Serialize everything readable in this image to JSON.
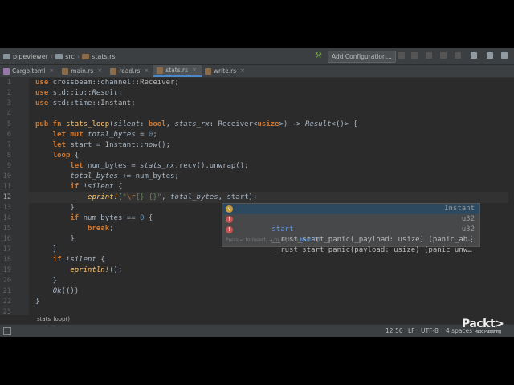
{
  "breadcrumbs": [
    "pipeviewer",
    "src",
    "stats.rs"
  ],
  "run_config": "Add Configuration...",
  "tabs": [
    {
      "label": "Cargo.toml",
      "color": "#9876aa",
      "active": false
    },
    {
      "label": "main.rs",
      "color": "#8a6b4a",
      "active": false
    },
    {
      "label": "read.rs",
      "color": "#8a6b4a",
      "active": false
    },
    {
      "label": "stats.rs",
      "color": "#8a6b4a",
      "active": true
    },
    {
      "label": "write.rs",
      "color": "#8a6b4a",
      "active": false
    }
  ],
  "line_numbers": [
    "1",
    "2",
    "3",
    "4",
    "5",
    "6",
    "7",
    "8",
    "9",
    "10",
    "11",
    "12",
    "13",
    "14",
    "15",
    "16",
    "17",
    "18",
    "19",
    "20",
    "21",
    "22",
    "23"
  ],
  "current_line": "12",
  "autocomplete": {
    "items": [
      {
        "name": "start",
        "type": "Instant",
        "icon": "variable-icon"
      },
      {
        "name": "__rust_start_panic(_payload: usize) (panic_ab…",
        "type": "u32",
        "icon": "function-icon"
      },
      {
        "name": "__rust_start_panic(payload: usize) (panic_unw…",
        "type": "u32",
        "icon": "function-icon"
      }
    ],
    "hint": "Press ↵ to insert, → to replace",
    "next_tip": "Next Tip"
  },
  "function_breadcrumb": "stats_loop()",
  "status": {
    "position": "12:50",
    "line_sep": "LF",
    "encoding": "UTF-8",
    "indent": "4 spaces"
  },
  "logo": {
    "text": "Packt>",
    "sub": "Packt Publishing"
  }
}
